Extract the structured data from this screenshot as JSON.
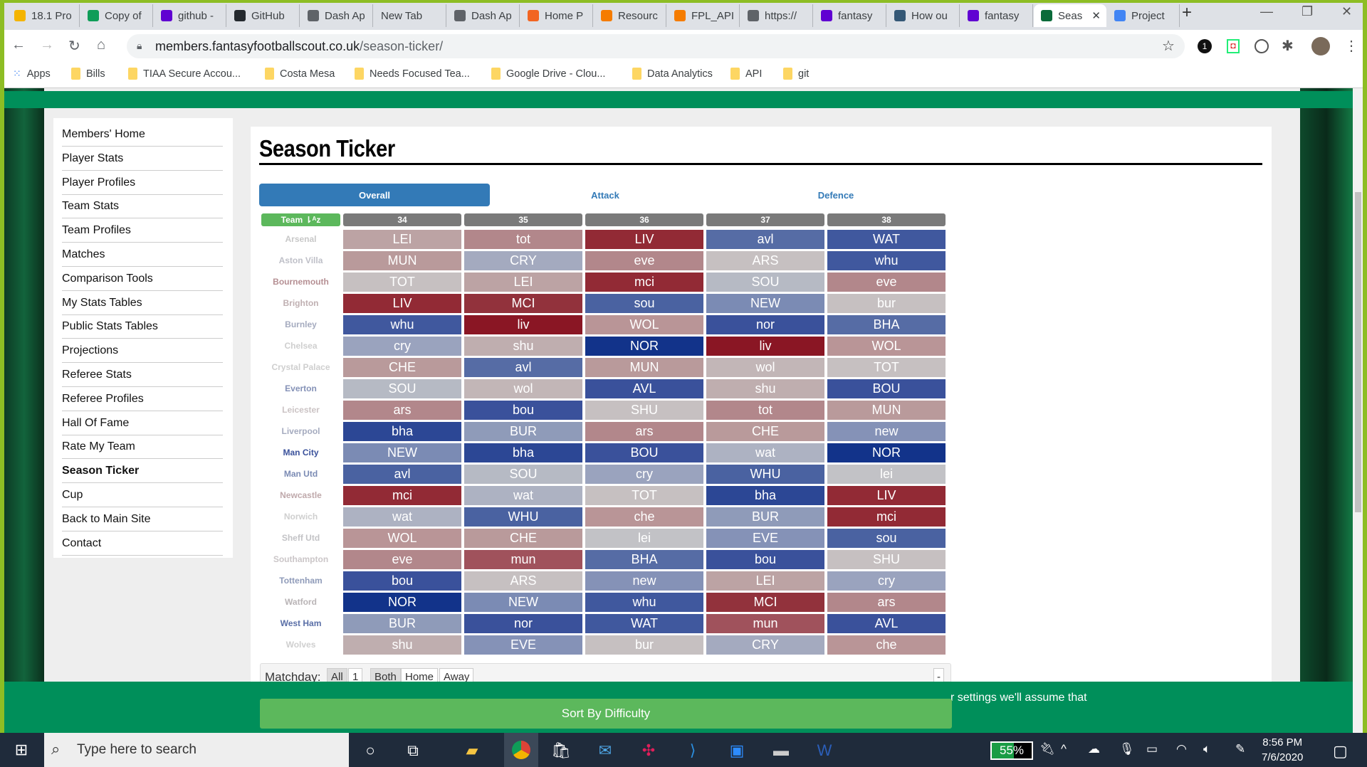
{
  "browser": {
    "tabs": [
      {
        "title": "18.1 Pro",
        "color": "#f4b400"
      },
      {
        "title": "Copy of",
        "color": "#0f9d58"
      },
      {
        "title": "github -",
        "color": "#6001d2"
      },
      {
        "title": "GitHub",
        "color": "#24292e"
      },
      {
        "title": "Dash Ap",
        "color": "#5f6368"
      },
      {
        "title": "New Tab",
        "color": ""
      },
      {
        "title": "Dash Ap",
        "color": "#5f6368"
      },
      {
        "title": "Home P",
        "color": "#f26522"
      },
      {
        "title": "Resourc",
        "color": "#f57c00"
      },
      {
        "title": "FPL_API",
        "color": "#f57c00"
      },
      {
        "title": "https://",
        "color": "#5f6368"
      },
      {
        "title": "fantasy",
        "color": "#6001d2"
      },
      {
        "title": "How ou",
        "color": "#355876"
      },
      {
        "title": "fantasy",
        "color": "#6001d2"
      },
      {
        "title": "Seas",
        "color": "#0b6b3a",
        "active": true
      },
      {
        "title": "Project",
        "color": "#4285f4"
      }
    ],
    "url_host": "members.fantasyfootballscout.co.uk",
    "url_path": "/season-ticker/",
    "bookmarks": [
      "Apps",
      "Bills",
      "TIAA Secure Accou...",
      "Costa Mesa",
      "Needs Focused Tea...",
      "Google Drive - Clou...",
      "Data Analytics",
      "API",
      "git"
    ]
  },
  "sidebar": {
    "items": [
      "Members' Home",
      "Player Stats",
      "Player Profiles",
      "Team Stats",
      "Team Profiles",
      "Matches",
      "Comparison Tools",
      "My Stats Tables",
      "Public Stats Tables",
      "Projections",
      "Referee Stats",
      "Referee Profiles",
      "Hall Of Fame",
      "Rate My Team",
      "Season Ticker",
      "Cup",
      "Back to Main Site",
      "Contact"
    ],
    "current": "Season Ticker"
  },
  "main": {
    "title": "Season Ticker",
    "tabs": [
      "Overall",
      "Attack",
      "Defence"
    ],
    "team_header": "Team ⇂ᴬz",
    "gameweeks": [
      "34",
      "35",
      "36",
      "37",
      "38"
    ],
    "rows": [
      {
        "team": "Arsenal",
        "color": "#c8c8c8",
        "fx": [
          [
            "LEI",
            "#bca3a4"
          ],
          [
            "tot",
            "#b2878b"
          ],
          [
            "LIV",
            "#922a35"
          ],
          [
            "avl",
            "#566ca5"
          ],
          [
            "WAT",
            "#40589e"
          ]
        ]
      },
      {
        "team": "Aston Villa",
        "color": "#bfc0c8",
        "fx": [
          [
            "MUN",
            "#b99a9b"
          ],
          [
            "CRY",
            "#a4aabf"
          ],
          [
            "eve",
            "#b2878b"
          ],
          [
            "ARS",
            "#c6c0c1"
          ],
          [
            "whu",
            "#40589e"
          ]
        ]
      },
      {
        "team": "Bournemouth",
        "color": "#b58f93",
        "fx": [
          [
            "TOT",
            "#c6c0c1"
          ],
          [
            "LEI",
            "#bca3a4"
          ],
          [
            "mci",
            "#922a35"
          ],
          [
            "SOU",
            "#b6bac4"
          ],
          [
            "eve",
            "#b2878b"
          ]
        ]
      },
      {
        "team": "Brighton",
        "color": "#c0b0b2",
        "fx": [
          [
            "LIV",
            "#922a35"
          ],
          [
            "MCI",
            "#92323c"
          ],
          [
            "sou",
            "#4a62a1"
          ],
          [
            "NEW",
            "#7b8bb4"
          ],
          [
            "bur",
            "#c6c0c1"
          ]
        ]
      },
      {
        "team": "Burnley",
        "color": "#a5abbf",
        "fx": [
          [
            "whu",
            "#40589e"
          ],
          [
            "liv",
            "#8a1624"
          ],
          [
            "WOL",
            "#b99597"
          ],
          [
            "nor",
            "#3a519b"
          ],
          [
            "BHA",
            "#566ca5"
          ]
        ]
      },
      {
        "team": "Chelsea",
        "color": "#cfcfcf",
        "fx": [
          [
            "cry",
            "#9aa3be"
          ],
          [
            "shu",
            "#bfaeaf"
          ],
          [
            "NOR",
            "#12338a"
          ],
          [
            "liv",
            "#8a1624"
          ],
          [
            "WOL",
            "#b99597"
          ]
        ]
      },
      {
        "team": "Crystal Palace",
        "color": "#cfcfcf",
        "fx": [
          [
            "CHE",
            "#b99a9b"
          ],
          [
            "avl",
            "#566ca5"
          ],
          [
            "MUN",
            "#b99a9b"
          ],
          [
            "wol",
            "#c2b6b7"
          ],
          [
            "TOT",
            "#c6c0c1"
          ]
        ]
      },
      {
        "team": "Everton",
        "color": "#8592b7",
        "fx": [
          [
            "SOU",
            "#b6bac4"
          ],
          [
            "wol",
            "#c2b6b7"
          ],
          [
            "AVL",
            "#3a519b"
          ],
          [
            "shu",
            "#bfaeaf"
          ],
          [
            "BOU",
            "#3a519b"
          ]
        ]
      },
      {
        "team": "Leicester",
        "color": "#cbc3c4",
        "fx": [
          [
            "ars",
            "#b2878b"
          ],
          [
            "bou",
            "#3a519b"
          ],
          [
            "SHU",
            "#c6c0c1"
          ],
          [
            "tot",
            "#b2878b"
          ],
          [
            "MUN",
            "#b99a9b"
          ]
        ]
      },
      {
        "team": "Liverpool",
        "color": "#a5abbf",
        "fx": [
          [
            "bha",
            "#2c4795"
          ],
          [
            "BUR",
            "#8f9bb9"
          ],
          [
            "ars",
            "#b2878b"
          ],
          [
            "CHE",
            "#b99a9b"
          ],
          [
            "new",
            "#8592b7"
          ]
        ]
      },
      {
        "team": "Man City",
        "color": "#3a519b",
        "fx": [
          [
            "NEW",
            "#7b8bb4"
          ],
          [
            "bha",
            "#2c4795"
          ],
          [
            "BOU",
            "#3a519b"
          ],
          [
            "wat",
            "#adb2c2"
          ],
          [
            "NOR",
            "#12338a"
          ]
        ]
      },
      {
        "team": "Man Utd",
        "color": "#7b8bb4",
        "fx": [
          [
            "avl",
            "#4a62a1"
          ],
          [
            "SOU",
            "#b6bac4"
          ],
          [
            "cry",
            "#9aa3be"
          ],
          [
            "WHU",
            "#4a62a1"
          ],
          [
            "lei",
            "#c2c2c6"
          ]
        ]
      },
      {
        "team": "Newcastle",
        "color": "#bfa9ab",
        "fx": [
          [
            "mci",
            "#922a35"
          ],
          [
            "wat",
            "#adb2c2"
          ],
          [
            "TOT",
            "#c6c0c1"
          ],
          [
            "bha",
            "#2c4795"
          ],
          [
            "LIV",
            "#922a35"
          ]
        ]
      },
      {
        "team": "Norwich",
        "color": "#cfcfcf",
        "fx": [
          [
            "wat",
            "#adb2c2"
          ],
          [
            "WHU",
            "#4a62a1"
          ],
          [
            "che",
            "#b99597"
          ],
          [
            "BUR",
            "#8f9bb9"
          ],
          [
            "mci",
            "#922a35"
          ]
        ]
      },
      {
        "team": "Sheff Utd",
        "color": "#c3c3c6",
        "fx": [
          [
            "WOL",
            "#b99597"
          ],
          [
            "CHE",
            "#b99a9b"
          ],
          [
            "lei",
            "#c2c2c6"
          ],
          [
            "EVE",
            "#8592b7"
          ],
          [
            "sou",
            "#4a62a1"
          ]
        ]
      },
      {
        "team": "Southampton",
        "color": "#cbc6c8",
        "fx": [
          [
            "eve",
            "#b2878b"
          ],
          [
            "mun",
            "#a0525c"
          ],
          [
            "BHA",
            "#566ca5"
          ],
          [
            "bou",
            "#3a519b"
          ],
          [
            "SHU",
            "#c6c0c1"
          ]
        ]
      },
      {
        "team": "Tottenham",
        "color": "#8f9bb9",
        "fx": [
          [
            "bou",
            "#3a519b"
          ],
          [
            "ARS",
            "#c6c0c1"
          ],
          [
            "new",
            "#8592b7"
          ],
          [
            "LEI",
            "#bca3a4"
          ],
          [
            "cry",
            "#9aa3be"
          ]
        ]
      },
      {
        "team": "Watford",
        "color": "#b9b4b6",
        "fx": [
          [
            "NOR",
            "#12338a"
          ],
          [
            "NEW",
            "#7b8bb4"
          ],
          [
            "whu",
            "#40589e"
          ],
          [
            "MCI",
            "#92323c"
          ],
          [
            "ars",
            "#b2878b"
          ]
        ]
      },
      {
        "team": "West Ham",
        "color": "#5a6fa7",
        "fx": [
          [
            "BUR",
            "#8f9bb9"
          ],
          [
            "nor",
            "#3a519b"
          ],
          [
            "WAT",
            "#40589e"
          ],
          [
            "mun",
            "#a0525c"
          ],
          [
            "AVL",
            "#3a519b"
          ]
        ]
      },
      {
        "team": "Wolves",
        "color": "#cfcfcf",
        "fx": [
          [
            "shu",
            "#bfaeaf"
          ],
          [
            "EVE",
            "#8592b7"
          ],
          [
            "bur",
            "#c6c0c1"
          ],
          [
            "CRY",
            "#a4aabf"
          ],
          [
            "che",
            "#b99597"
          ]
        ]
      }
    ],
    "matchday_label": "Matchday:",
    "matchday_buttons": [
      "All",
      "1"
    ],
    "venue_buttons": [
      "Both",
      "Home",
      "Away"
    ],
    "collapse_label": "-",
    "sort_button": "Sort By Difficulty"
  },
  "cookie_text": "r settings we'll assume that",
  "taskbar": {
    "search_placeholder": "Type here to search",
    "battery": "55%",
    "time": "8:56 PM",
    "date": "7/6/2020"
  }
}
